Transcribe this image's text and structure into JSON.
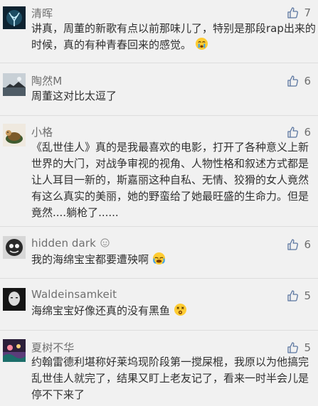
{
  "comments": [
    {
      "author": "清晖",
      "likes": "7",
      "text": "讲真，周董的新歌有点以前那味儿了，特别是那段rap出来的时候，真的有种青春回来的感觉。",
      "emoji": "crying-face-icon"
    },
    {
      "author": "陶然M",
      "likes": "6",
      "text": "周董这对比太逗了"
    },
    {
      "author": "小格",
      "likes": "6",
      "text": "《乱世佳人》真的是我最喜欢的电影，打开了各种意义上新世界的大门，对战争审视的视角、人物性格和叙述方式都是让人耳目一新的，斯嘉丽这种自私、无情、狡猾的女人竟然有这么真实的美丽，她的野蛮给了她最旺盛的生命力。但是竟然....躺枪了......"
    },
    {
      "author": "hidden dark",
      "author_suffix_icon": "bubble-icon",
      "likes": "6",
      "text": "我的海绵宝宝都要遭殃啊",
      "emoji": "sobbing-face-icon"
    },
    {
      "author": "Waldeinsamkeit",
      "likes": "5",
      "text": "海绵宝宝好像还真的没有黑鱼",
      "emoji": "dizzy-face-icon"
    },
    {
      "author": "夏树不华",
      "likes": "5",
      "text": "约翰雷德利堪称好莱坞现阶段第一搅屎棍，我原以为他搞完乱世佳人就完了，结果又盯上老友记了，看来一时半会儿是停不下来了"
    }
  ],
  "icons": {
    "like": "thumbs-up-icon"
  },
  "colors": {
    "background": "#f1f1f1",
    "author": "#6f6f6f",
    "text": "#303030",
    "divider": "#dddddd"
  }
}
